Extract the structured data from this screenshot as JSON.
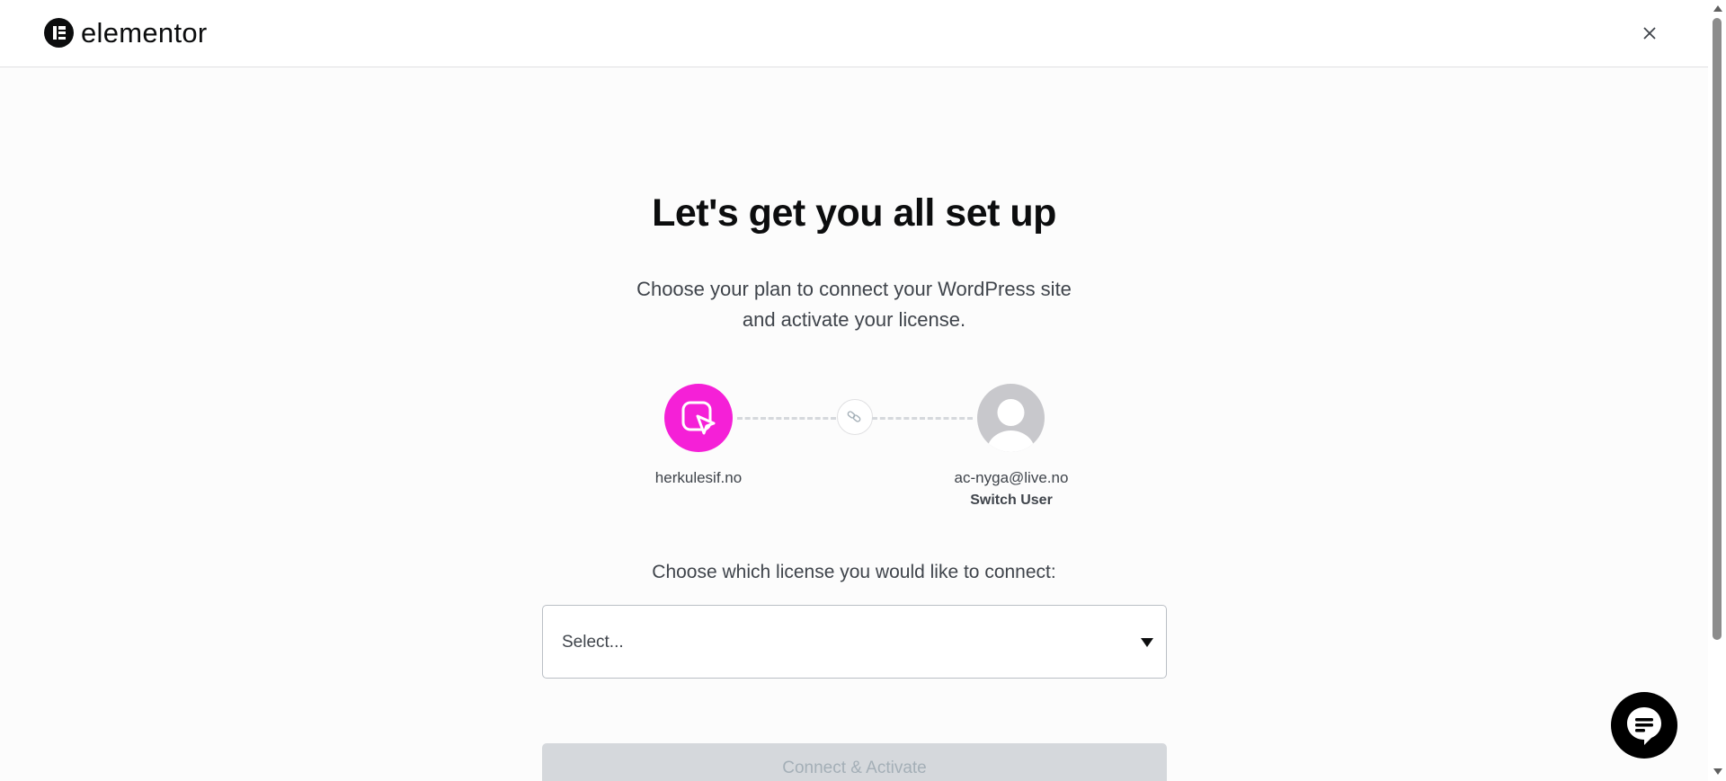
{
  "header": {
    "brand": "elementor",
    "close_icon": "close-icon"
  },
  "main": {
    "title": "Let's get you all set up",
    "subtitle_line1": "Choose your plan to connect your WordPress site",
    "subtitle_line2": "and activate your license.",
    "site_label": "herkulesif.no",
    "user_email": "ac-nyga@live.no",
    "switch_user": "Switch User",
    "choose_license": "Choose which license you would like to connect:",
    "select_value": "Select...",
    "connect_button": "Connect & Activate"
  },
  "colors": {
    "accent_pink": "#f520d7",
    "text_dark": "#0c0d0e",
    "text_muted": "#3f444b",
    "button_disabled_bg": "#d5d8dc"
  },
  "icons": {
    "site": "cursor-square-icon",
    "link": "link-icon",
    "user": "user-avatar-icon",
    "chat": "chat-icon"
  }
}
